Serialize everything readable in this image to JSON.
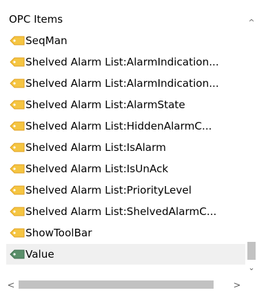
{
  "list": {
    "header": "OPC Items",
    "items": [
      {
        "label": "SeqMan",
        "icon": "tag-icon",
        "color": "#f5c542"
      },
      {
        "label": "Shelved Alarm List:AlarmIndication...",
        "icon": "tag-icon",
        "color": "#f5c542"
      },
      {
        "label": "Shelved Alarm List:AlarmIndication...",
        "icon": "tag-icon",
        "color": "#f5c542"
      },
      {
        "label": "Shelved Alarm List:AlarmState",
        "icon": "tag-icon",
        "color": "#f5c542"
      },
      {
        "label": "Shelved Alarm List:HiddenAlarmC...",
        "icon": "tag-icon",
        "color": "#f5c542"
      },
      {
        "label": "Shelved Alarm List:IsAlarm",
        "icon": "tag-icon",
        "color": "#f5c542"
      },
      {
        "label": "Shelved Alarm List:IsUnAck",
        "icon": "tag-icon",
        "color": "#f5c542"
      },
      {
        "label": "Shelved Alarm List:PriorityLevel",
        "icon": "tag-icon",
        "color": "#f5c542"
      },
      {
        "label": "Shelved Alarm List:ShelvedAlarmC...",
        "icon": "tag-icon",
        "color": "#f5c542"
      },
      {
        "label": "ShowToolBar",
        "icon": "tag-icon",
        "color": "#f5c542"
      },
      {
        "label": "Value",
        "icon": "tag-icon",
        "color": "#5a8f6a",
        "selected": true
      }
    ]
  },
  "scrollbars": {
    "up_glyph": "^",
    "down_glyph": "⌄",
    "left_glyph": "<",
    "right_glyph": ">"
  }
}
